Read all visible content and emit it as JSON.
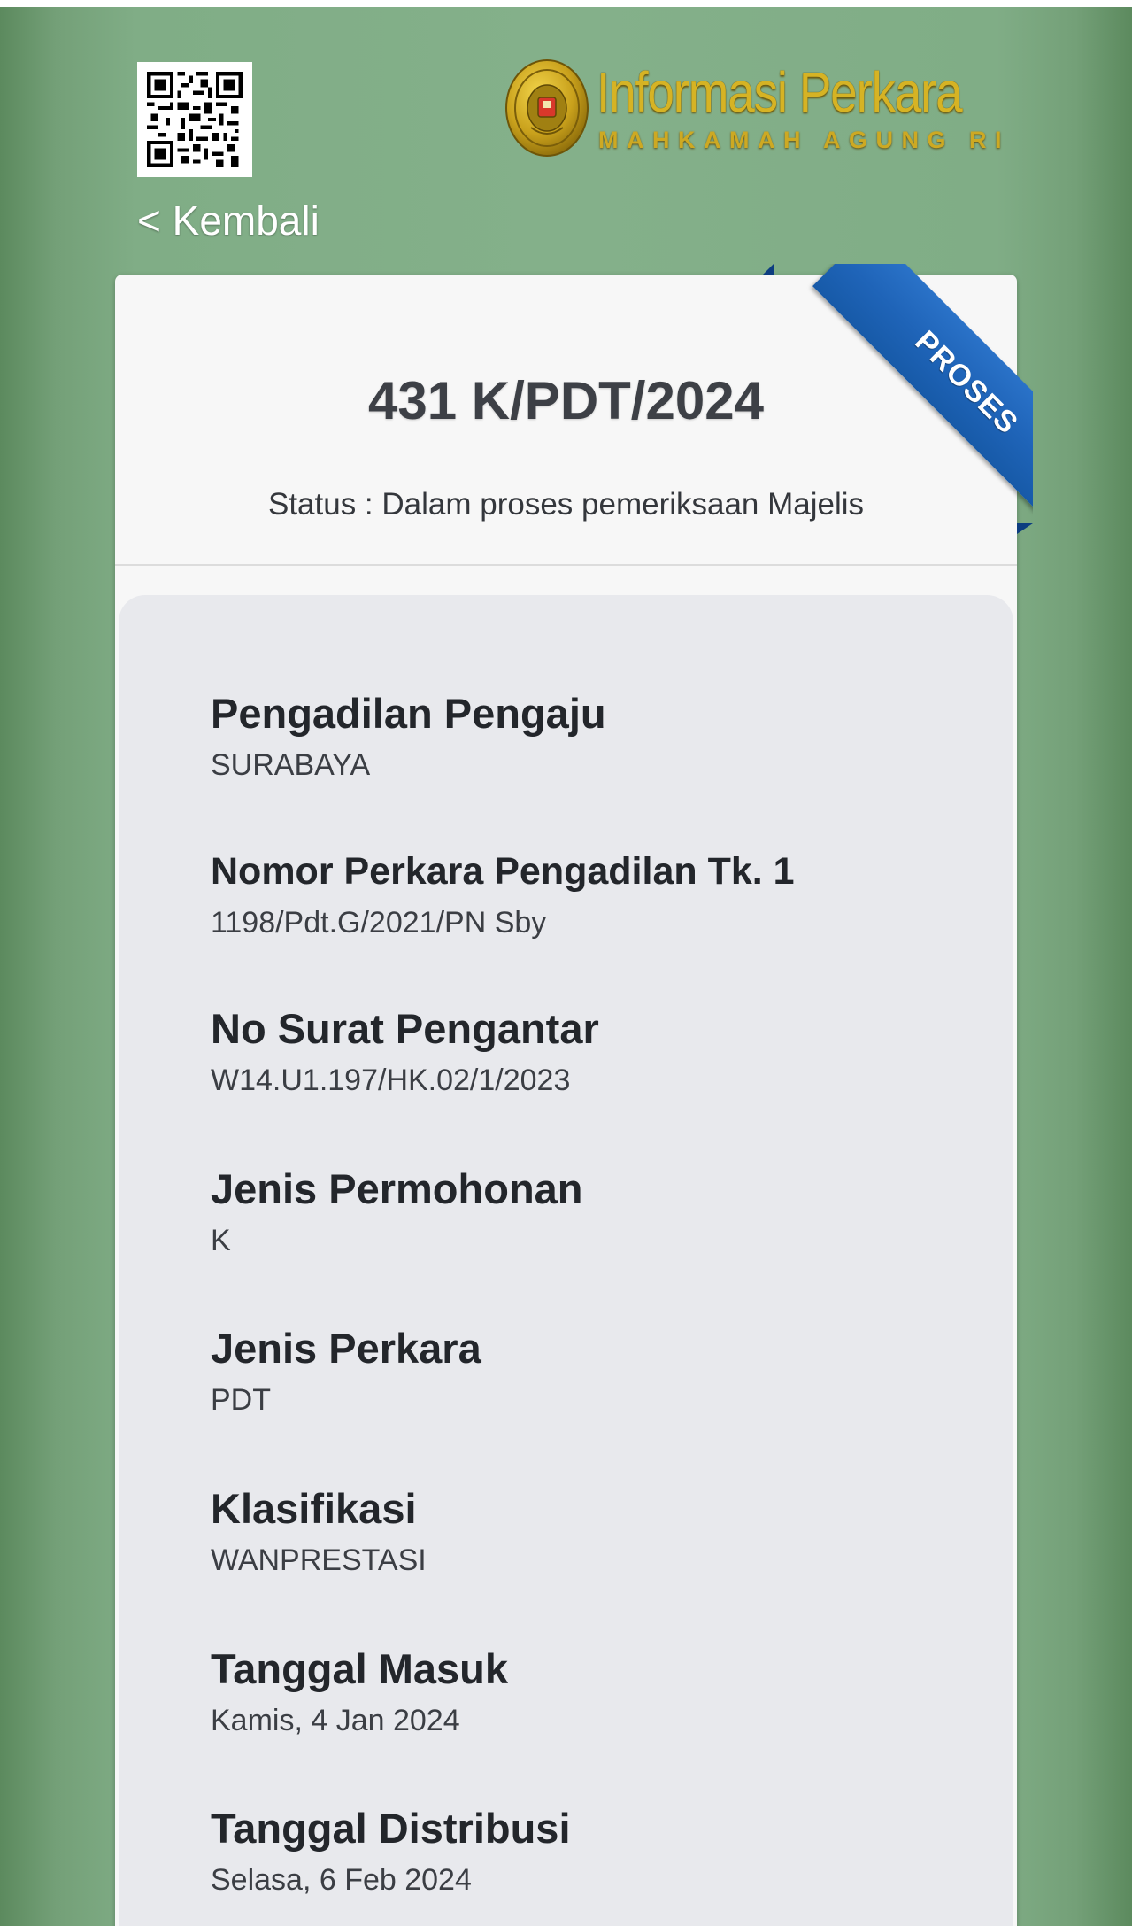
{
  "header": {
    "logo_title": "Informasi Perkara",
    "logo_subtitle": "MAHKAMAH AGUNG RI",
    "back_label": "< Kembali"
  },
  "case": {
    "number": "431 K/PDT/2024",
    "status_prefix": "Status : ",
    "status_value": "Dalam proses pemeriksaan Majelis",
    "ribbon_label": "PROSES"
  },
  "details": [
    {
      "label": "Pengadilan Pengaju",
      "value": "SURABAYA"
    },
    {
      "label": "Nomor Perkara Pengadilan Tk. 1",
      "value": "1198/Pdt.G/2021/PN Sby"
    },
    {
      "label": "No Surat Pengantar",
      "value": "W14.U1.197/HK.02/1/2023"
    },
    {
      "label": "Jenis Permohonan",
      "value": "K"
    },
    {
      "label": "Jenis Perkara",
      "value": "PDT"
    },
    {
      "label": "Klasifikasi",
      "value": "WANPRESTASI"
    },
    {
      "label": "Tanggal Masuk",
      "value": "Kamis, 4 Jan 2024"
    },
    {
      "label": "Tanggal Distribusi",
      "value": "Selasa, 6 Feb 2024"
    }
  ],
  "colors": {
    "background_green": "#84b08a",
    "logo_gold": "#d6b324",
    "ribbon_blue": "#1f64b8",
    "card_bg": "#f7f7f7",
    "panel_bg": "#e8e9ed",
    "label_text": "#23262b"
  },
  "icons": {
    "qr": "qr-code-icon",
    "seal": "court-seal-icon"
  }
}
